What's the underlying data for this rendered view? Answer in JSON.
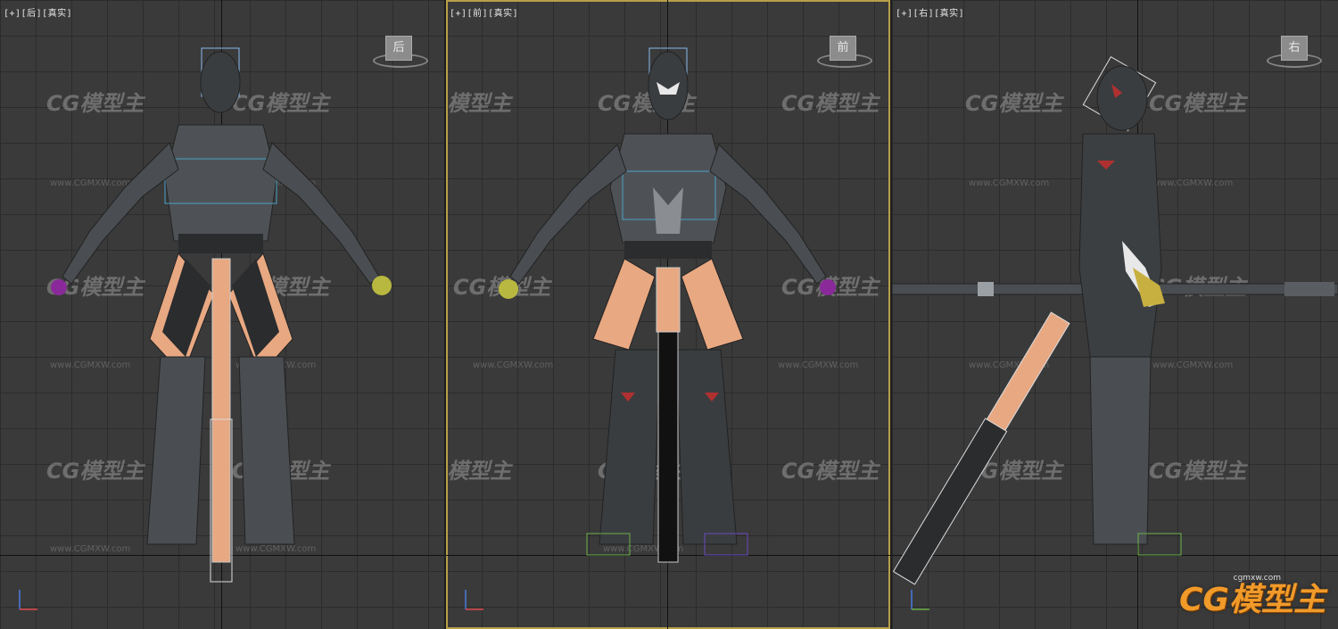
{
  "viewports": {
    "left": {
      "label": "[+][后][真实]",
      "viewcube_label": "后"
    },
    "front": {
      "label": "[+][前][真实]",
      "viewcube_label": "前"
    },
    "right": {
      "label": "[+][右][真实]",
      "viewcube_label": "右"
    }
  },
  "watermark": {
    "text": "CG模型主",
    "url": "www.CGMXW.com"
  },
  "brand": {
    "logo": "CG模型主",
    "url": "cgmxw.com"
  },
  "colors": {
    "accent_border": "#b8a04a",
    "skin": "#e8a882",
    "armor": "#4a4e52",
    "logo": "#f09a2a"
  }
}
